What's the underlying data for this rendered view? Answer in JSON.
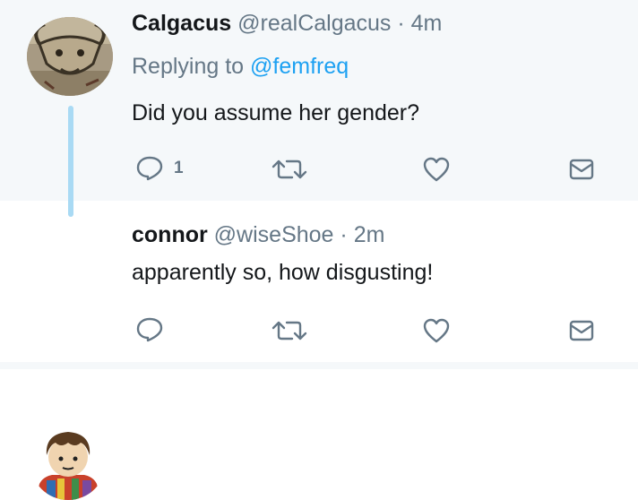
{
  "tweets": [
    {
      "name": "Calgacus",
      "handle": "@realCalgacus",
      "separator": "·",
      "time": "4m",
      "replying_prefix": "Replying to",
      "replying_to": "@femfreq",
      "text": "Did you assume her gender?",
      "reply_count": "1",
      "avatar_icon": "mosaic-bull-avatar-icon"
    },
    {
      "name": "connor",
      "handle": "@wiseShoe",
      "separator": "·",
      "time": "2m",
      "text": "apparently so, how disgusting!",
      "avatar_icon": "lego-figure-avatar-icon"
    }
  ],
  "colors": {
    "accent": "#1da1f2",
    "secondary_text": "#657786",
    "thread_line": "#a9daf4",
    "highlight_background": "#f5f8fa"
  },
  "icons": [
    "reply-icon",
    "retweet-icon",
    "like-icon",
    "direct-message-icon"
  ]
}
